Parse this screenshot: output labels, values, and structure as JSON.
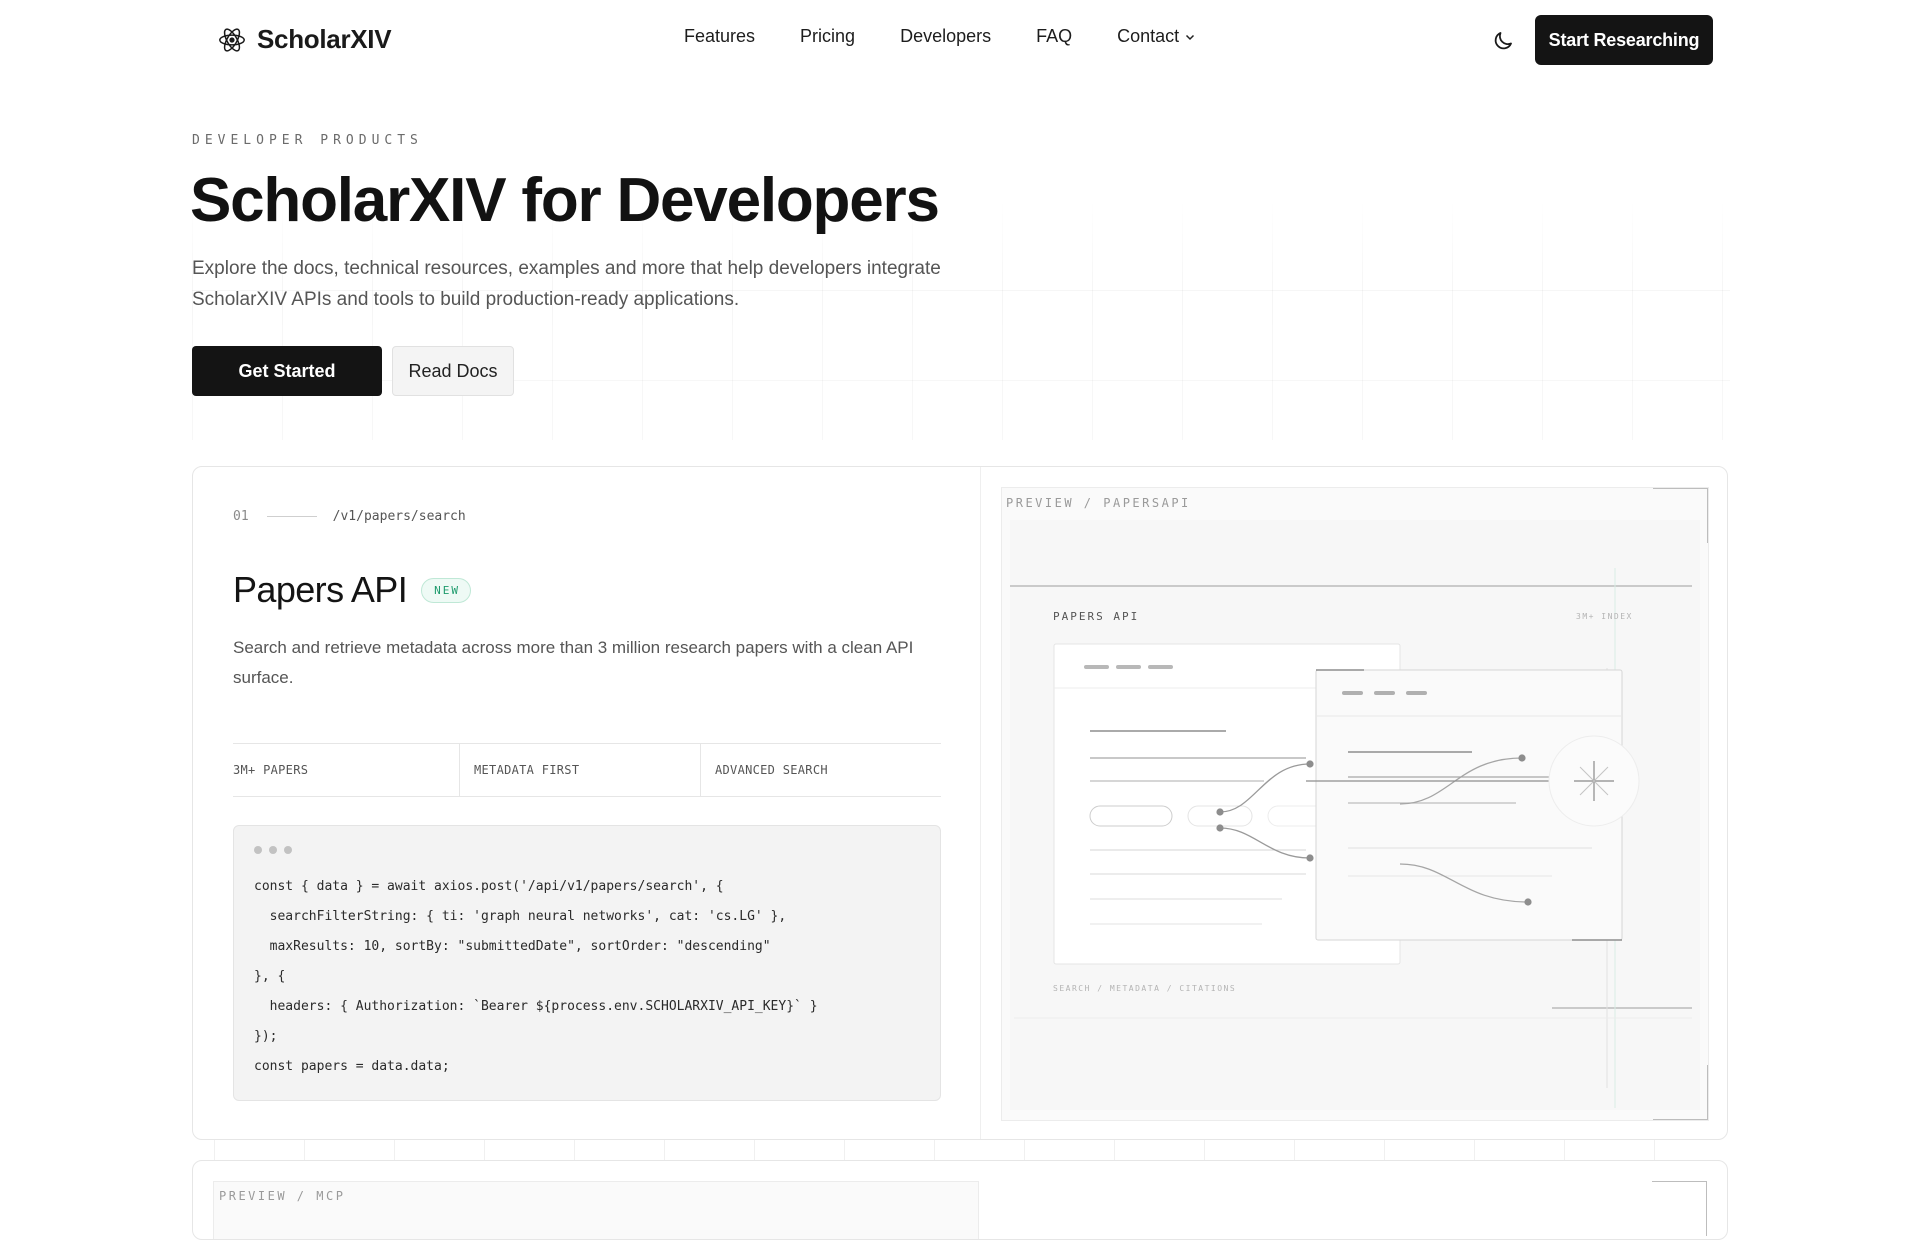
{
  "header": {
    "brand": "ScholarXIV",
    "nav": [
      "Features",
      "Pricing",
      "Developers",
      "FAQ"
    ],
    "contact_label": "Contact",
    "cta_label": "Start Researching"
  },
  "hero": {
    "eyebrow": "DEVELOPER PRODUCTS",
    "title": "ScholarXIV for Developers",
    "subtitle_line1": "Explore the docs, technical resources, examples and more that help developers integrate",
    "subtitle_line2": "ScholarXIV APIs and tools to build production-ready applications.",
    "primary_button": "Get Started",
    "secondary_button": "Read Docs"
  },
  "product": {
    "step": "01",
    "endpoint": "/v1/papers/search",
    "title": "Papers API",
    "badge": "NEW",
    "description": "Search and retrieve metadata across more than 3 million research papers with a clean API surface.",
    "features": [
      "3M+ PAPERS",
      "METADATA FIRST",
      "ADVANCED SEARCH"
    ],
    "code": [
      "const { data } = await axios.post('/api/v1/papers/search', {",
      "  searchFilterString: { ti: 'graph neural networks', cat: 'cs.LG' },",
      "  maxResults: 10, sortBy: \"submittedDate\", sortOrder: \"descending\"",
      "}, {",
      "  headers: { Authorization: `Bearer ${process.env.SCHOLARXIV_API_KEY}` }",
      "});",
      "const papers = data.data;"
    ],
    "preview": {
      "label": "PREVIEW / PAPERSAPI",
      "diagram_title": "PAPERS API",
      "diagram_tag": "3M+ INDEX",
      "diagram_footer": "SEARCH / METADATA / CITATIONS"
    }
  },
  "next_product": {
    "preview_label": "PREVIEW / MCP"
  },
  "icons": {
    "brand": "atom-icon",
    "theme": "moon-icon",
    "contact": "chevron-down-icon"
  },
  "colors": {
    "primary_button": "#141414",
    "badge_text": "#1e9b6d",
    "badge_bg": "#eefaf5"
  }
}
